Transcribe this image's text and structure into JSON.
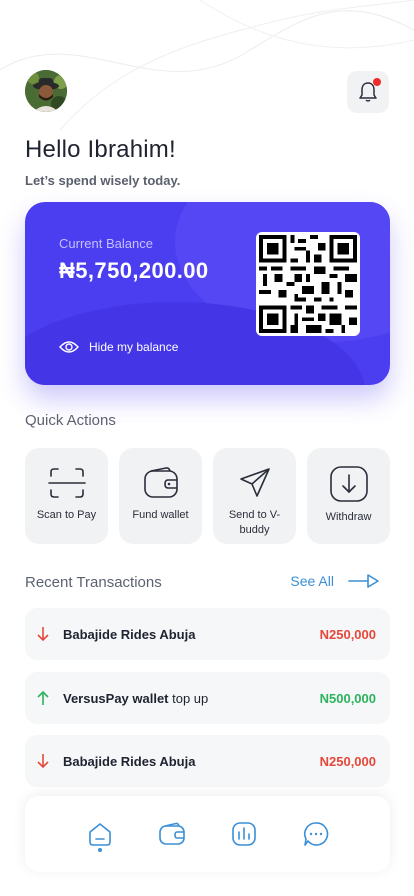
{
  "colors": {
    "accent": "#3a8fd6",
    "card": "#4b3ef0",
    "debit": "#e5483a",
    "credit": "#2db35e"
  },
  "header": {
    "avatar_icon": "avatar",
    "notification_icon": "bell-icon"
  },
  "greeting": {
    "title": "Hello Ibrahim!",
    "subtitle": "Let’s spend wisely today."
  },
  "card": {
    "label": "Current Balance",
    "balance": "₦5,750,200.00",
    "hide_label": "Hide my balance"
  },
  "quick_actions": {
    "title": "Quick Actions",
    "items": [
      {
        "label": "Scan to Pay",
        "icon": "scan-icon"
      },
      {
        "label": "Fund wallet",
        "icon": "wallet-icon"
      },
      {
        "label": "Send to V-buddy",
        "icon": "send-icon"
      },
      {
        "label": "Withdraw",
        "icon": "download-icon"
      }
    ]
  },
  "transactions": {
    "title": "Recent Transactions",
    "see_all": "See All",
    "items": [
      {
        "name": "Babajide Rides Abuja",
        "extra": "",
        "amount": "N250,000",
        "type": "debit"
      },
      {
        "name": "VersusPay wallet",
        "extra": " top up",
        "amount": "N500,000",
        "type": "credit"
      },
      {
        "name": "Babajide Rides Abuja",
        "extra": "",
        "amount": "N250,000",
        "type": "debit"
      }
    ]
  },
  "nav": {
    "items": [
      "home-icon",
      "wallet-icon",
      "stats-icon",
      "chat-icon"
    ],
    "active": "home-icon"
  }
}
